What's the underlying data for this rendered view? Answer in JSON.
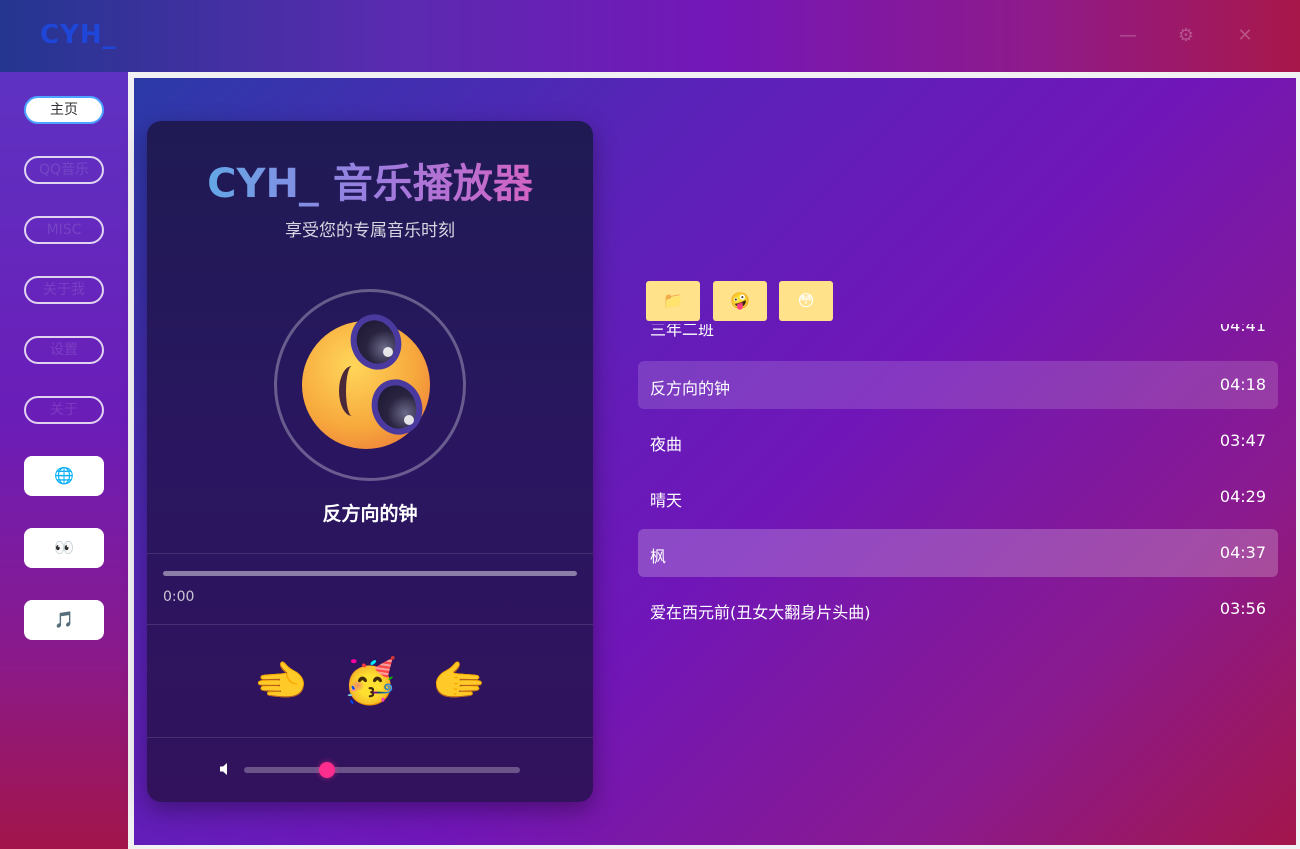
{
  "app": {
    "title": "CYH_"
  },
  "window_controls": {
    "minimize": "—",
    "settings": "⚙",
    "close": "✕"
  },
  "sidebar": {
    "pills": [
      {
        "label": "主页",
        "active": true
      },
      {
        "label": "QQ音乐",
        "active": false
      },
      {
        "label": "MISC",
        "active": false
      },
      {
        "label": "关于我",
        "active": false
      },
      {
        "label": "设置",
        "active": false
      },
      {
        "label": "关于",
        "active": false
      }
    ],
    "squares": [
      {
        "icon": "globe-icon",
        "glyph": "🌐"
      },
      {
        "icon": "eyes-icon",
        "glyph": "👀"
      },
      {
        "icon": "music-note-icon",
        "glyph": "🎵"
      }
    ]
  },
  "player": {
    "title": "CYH_ 音乐播放器",
    "subtitle": "享受您的专属音乐时刻",
    "now_playing": "反方向的钟",
    "current_time": "0:00",
    "progress": 0,
    "volume": 0.3,
    "controls": {
      "prev": "🫲",
      "play": "🥳",
      "next": "🫱"
    }
  },
  "toolbar": [
    {
      "icon": "folder-icon",
      "glyph": "📁"
    },
    {
      "icon": "silly-face-icon",
      "glyph": "🤪"
    },
    {
      "icon": "blush-face-icon",
      "glyph": "😳"
    }
  ],
  "playlist": [
    {
      "name": "三年二班",
      "duration": "04:41",
      "highlight": "none"
    },
    {
      "name": "反方向的钟",
      "duration": "04:18",
      "highlight": "hover"
    },
    {
      "name": "夜曲",
      "duration": "03:47",
      "highlight": "none"
    },
    {
      "name": "晴天",
      "duration": "04:29",
      "highlight": "none"
    },
    {
      "name": "枫",
      "duration": "04:37",
      "highlight": "selected"
    },
    {
      "name": "爱在西元前(丑女大翻身片头曲)",
      "duration": "03:56",
      "highlight": "none"
    }
  ],
  "colors": {
    "accent_pink": "#ff2d8d",
    "logo_blue": "#1e46d8",
    "toolbar_yellow": "#ffe28a"
  }
}
